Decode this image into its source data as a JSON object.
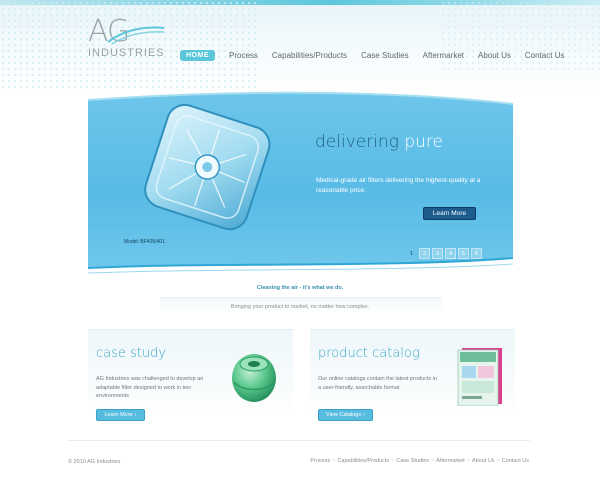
{
  "logo": {
    "letters": "AG",
    "sub": "INDUSTRIES"
  },
  "nav": [
    {
      "label": "HOME",
      "active": true
    },
    {
      "label": "Process"
    },
    {
      "label": "Capabilities/Products"
    },
    {
      "label": "Case Studies"
    },
    {
      "label": "Aftermarket"
    },
    {
      "label": "About Us"
    },
    {
      "label": "Contact Us"
    }
  ],
  "hero": {
    "title_main": "delivering ",
    "title_accent": "pure",
    "description": "Medical-grade air filters delivering the highest-quality at a reasonable price.",
    "button": "Learn More",
    "model_label": "Model: BF405/401",
    "pages": [
      "1",
      "2",
      "3",
      "4",
      "5",
      "6"
    ],
    "active_page": "1"
  },
  "tagline": "Cleaning the air - it's what we do.",
  "subtagline": "Bringing your product to market, no matter how complex.",
  "cards": {
    "case_study": {
      "title": "case study",
      "text": "AG Industries was challenged to develop an adaptable filter designed to work in two environments",
      "button": "Learn More",
      "chevron": "›"
    },
    "product_catalog": {
      "title": "product catalog",
      "text": "Our online catalogs contain the latest products in a user-friendly, searchable format",
      "button": "View Catalogs",
      "chevron": "›"
    }
  },
  "footer": {
    "copyright": "© 2010 AG Industries",
    "links": [
      "Process",
      "Capabilities/Products",
      "Case Studies",
      "Aftermarket",
      "About Us",
      "Contact Us"
    ],
    "separator": "~"
  },
  "colors": {
    "accent": "#5ac6da",
    "hero_blue": "#58bbe6",
    "button_dark": "#1d5c8d",
    "title_blue": "#3aa6c9"
  }
}
